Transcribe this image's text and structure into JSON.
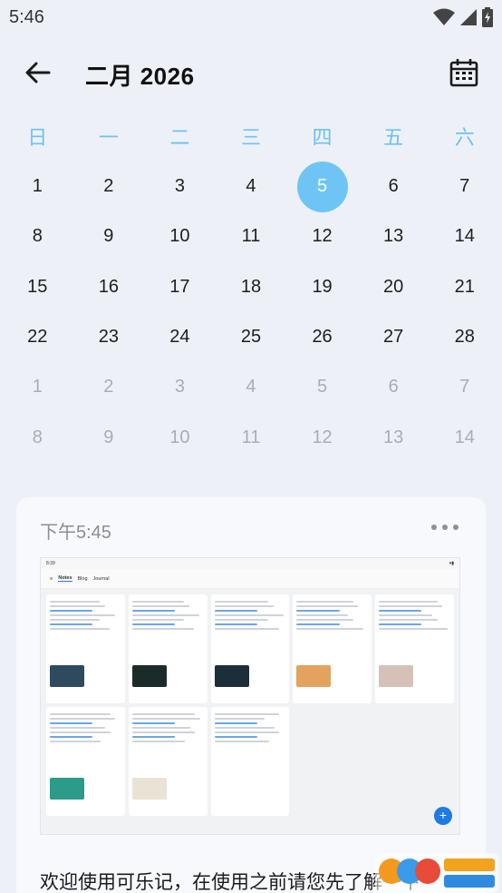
{
  "status_bar": {
    "time": "5:46"
  },
  "header": {
    "month_title": "二月 2026"
  },
  "calendar": {
    "weekdays": [
      "日",
      "一",
      "二",
      "三",
      "四",
      "五",
      "六"
    ],
    "days": [
      {
        "label": "1",
        "other": false
      },
      {
        "label": "2",
        "other": false
      },
      {
        "label": "3",
        "other": false
      },
      {
        "label": "4",
        "other": false
      },
      {
        "label": "5",
        "other": false,
        "today": true
      },
      {
        "label": "6",
        "other": false
      },
      {
        "label": "7",
        "other": false
      },
      {
        "label": "8",
        "other": false
      },
      {
        "label": "9",
        "other": false
      },
      {
        "label": "10",
        "other": false
      },
      {
        "label": "11",
        "other": false
      },
      {
        "label": "12",
        "other": false
      },
      {
        "label": "13",
        "other": false
      },
      {
        "label": "14",
        "other": false
      },
      {
        "label": "15",
        "other": false
      },
      {
        "label": "16",
        "other": false
      },
      {
        "label": "17",
        "other": false
      },
      {
        "label": "18",
        "other": false
      },
      {
        "label": "19",
        "other": false
      },
      {
        "label": "20",
        "other": false
      },
      {
        "label": "21",
        "other": false
      },
      {
        "label": "22",
        "other": false
      },
      {
        "label": "23",
        "other": false
      },
      {
        "label": "24",
        "other": false
      },
      {
        "label": "25",
        "other": false
      },
      {
        "label": "26",
        "other": false
      },
      {
        "label": "27",
        "other": false
      },
      {
        "label": "28",
        "other": false
      },
      {
        "label": "1",
        "other": true
      },
      {
        "label": "2",
        "other": true
      },
      {
        "label": "3",
        "other": true
      },
      {
        "label": "4",
        "other": true
      },
      {
        "label": "5",
        "other": true
      },
      {
        "label": "6",
        "other": true
      },
      {
        "label": "7",
        "other": true
      },
      {
        "label": "8",
        "other": true
      },
      {
        "label": "9",
        "other": true
      },
      {
        "label": "10",
        "other": true
      },
      {
        "label": "11",
        "other": true
      },
      {
        "label": "12",
        "other": true
      },
      {
        "label": "13",
        "other": true
      },
      {
        "label": "14",
        "other": true
      }
    ]
  },
  "note": {
    "time": "下午5:45",
    "text": "欢迎使用可乐记，在使用之前请您先了解一下",
    "thumbnail": {
      "time": "8:39",
      "tabs": [
        "Notes",
        "Blog",
        "Journal"
      ]
    }
  },
  "colors": {
    "accent": "#6ec5f5",
    "weekday": "#6cc2f2",
    "background": "#edf1f7"
  }
}
